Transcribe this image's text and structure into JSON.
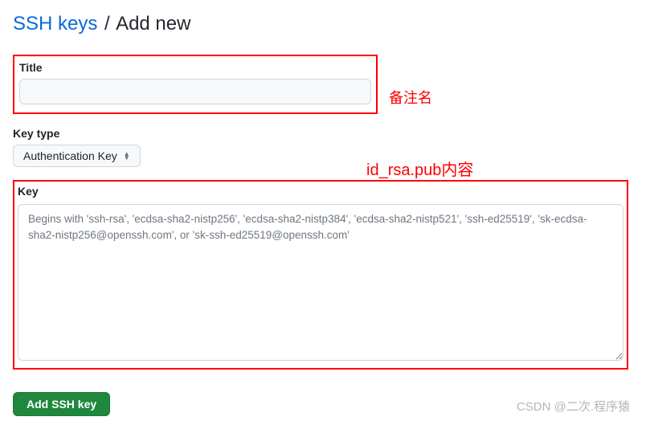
{
  "heading": {
    "link_text": "SSH keys",
    "separator": "/",
    "current": "Add new"
  },
  "title_section": {
    "label": "Title",
    "value": ""
  },
  "keytype_section": {
    "label": "Key type",
    "selected": "Authentication Key"
  },
  "key_section": {
    "label": "Key",
    "placeholder": "Begins with 'ssh-rsa', 'ecdsa-sha2-nistp256', 'ecdsa-sha2-nistp384', 'ecdsa-sha2-nistp521', 'ssh-ed25519', 'sk-ecdsa-sha2-nistp256@openssh.com', or 'sk-ssh-ed25519@openssh.com'"
  },
  "submit_label": "Add SSH key",
  "annotations": {
    "title_note": "备注名",
    "key_note": "id_rsa.pub内容"
  },
  "watermark": "CSDN @二次.程序猿"
}
